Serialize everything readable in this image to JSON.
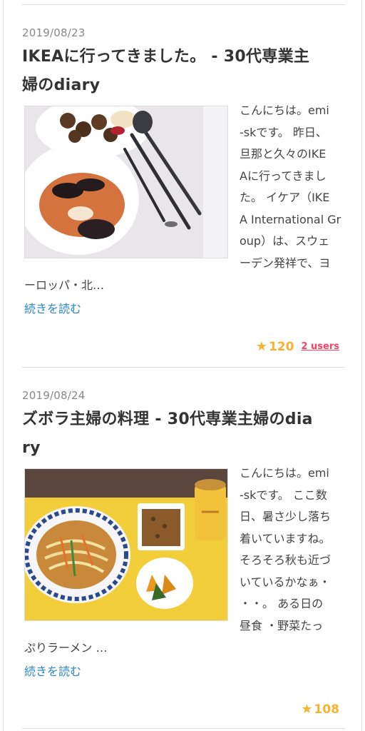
{
  "entries": [
    {
      "date": "2019/08/23",
      "title_line1": "IKEAに行ってきました。 - 30代専業主",
      "title_line2": "婦のdiary",
      "excerpt_side": [
        "こんにちは。emi",
        "-skです。 昨日、",
        "旦那と久々のIKE",
        "Aに行ってきまし",
        "た。 イケア（IKE",
        "A International Gr",
        "oup）は、スウェ",
        "ーデン発祥で、ヨ"
      ],
      "excerpt_bottom": "ーロッパ・北…",
      "read_more": "続きを読む",
      "stars": "120",
      "users": "2 users",
      "image_icon": "ikea-meal-photo"
    },
    {
      "date": "2019/08/24",
      "title_line1": "ズボラ主婦の料理 - 30代専業主婦のdia",
      "title_line2": "ry",
      "excerpt_side": [
        "こんにちは。emi",
        "-skです。 ここ数",
        "日、暑さ少し落ち",
        "着いていますね。",
        "そろそろ秋も近づ",
        "いているかなぁ・",
        "・・。 ある日の",
        "昼食 ・野菜たっ"
      ],
      "excerpt_bottom": "ぷりラーメン …",
      "read_more": "続きを読む",
      "stars": "108",
      "image_icon": "ramen-lunch-photo"
    }
  ],
  "colors": {
    "link": "#2b86c5",
    "star": "#f5b32f",
    "users": "#ff4166"
  },
  "star_icon": "star-icon"
}
